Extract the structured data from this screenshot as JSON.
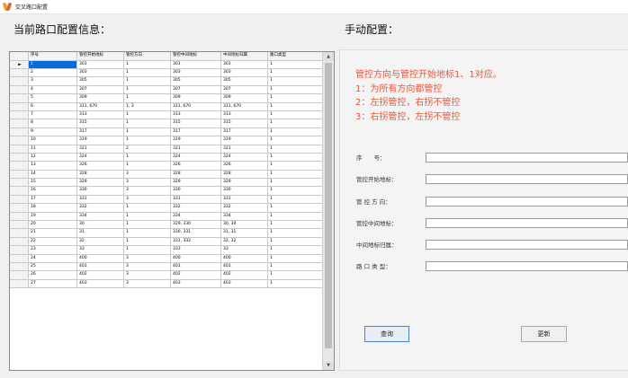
{
  "window": {
    "title": "交叉路口配置"
  },
  "left": {
    "heading": "当前路口配置信息："
  },
  "right": {
    "heading": "手动配置：",
    "notes": [
      "管控方向与管控开始地标1、1对应。",
      "1：为所有方向都管控",
      "2：左拐管控，右拐不管控",
      "3：右拐管控，左拐不管控"
    ],
    "form": [
      {
        "label": "序　　号：",
        "value": ""
      },
      {
        "label": "管控开始地标：",
        "value": ""
      },
      {
        "label": "管 控 方 向：",
        "value": ""
      },
      {
        "label": "管控中间地标：",
        "value": ""
      },
      {
        "label": "中间地标归属：",
        "value": ""
      },
      {
        "label": "路 口 类 型：",
        "value": ""
      }
    ],
    "buttons": {
      "query": "查询",
      "update": "更新"
    }
  },
  "grid": {
    "selected_indicator": "►",
    "columns": [
      "序号",
      "管控开始地标",
      "管控方向",
      "管控中间地标",
      "中间地标归属",
      "路口类型"
    ],
    "rows": [
      [
        "1",
        "301",
        "1",
        "301",
        "301",
        "1"
      ],
      [
        "2",
        "303",
        "1",
        "303",
        "303",
        "1"
      ],
      [
        "3",
        "305",
        "1",
        "305",
        "305",
        "1"
      ],
      [
        "4",
        "307",
        "1",
        "307",
        "307",
        "1"
      ],
      [
        "5",
        "309",
        "1",
        "309",
        "309",
        "1"
      ],
      [
        "6",
        "311, 670",
        "1, 3",
        "311, 670",
        "311, 670",
        "1"
      ],
      [
        "7",
        "313",
        "1",
        "313",
        "313",
        "1"
      ],
      [
        "8",
        "315",
        "1",
        "315",
        "315",
        "1"
      ],
      [
        "9",
        "317",
        "1",
        "317",
        "317",
        "1"
      ],
      [
        "10",
        "319",
        "1",
        "319",
        "319",
        "1"
      ],
      [
        "11",
        "321",
        "2",
        "321",
        "321",
        "1"
      ],
      [
        "12",
        "324",
        "1",
        "324",
        "324",
        "1"
      ],
      [
        "13",
        "326",
        "1",
        "326",
        "326",
        "1"
      ],
      [
        "14",
        "328",
        "3",
        "328",
        "328",
        "1"
      ],
      [
        "15",
        "329",
        "3",
        "329",
        "329",
        "1"
      ],
      [
        "16",
        "330",
        "3",
        "330",
        "330",
        "1"
      ],
      [
        "17",
        "331",
        "3",
        "331",
        "331",
        "1"
      ],
      [
        "18",
        "332",
        "1",
        "332",
        "332",
        "1"
      ],
      [
        "19",
        "334",
        "1",
        "334",
        "334",
        "1"
      ],
      [
        "20",
        "30",
        "1",
        "329, 330",
        "30, 30",
        "1"
      ],
      [
        "21",
        "31",
        "1",
        "330, 331",
        "31, 31",
        "1"
      ],
      [
        "22",
        "32",
        "1",
        "331, 332",
        "32, 32",
        "1"
      ],
      [
        "23",
        "33",
        "1",
        "333",
        "33",
        "1"
      ],
      [
        "24",
        "400",
        "3",
        "400",
        "400",
        "1"
      ],
      [
        "25",
        "401",
        "3",
        "401",
        "401",
        "1"
      ],
      [
        "26",
        "402",
        "3",
        "402",
        "402",
        "1"
      ],
      [
        "27",
        "403",
        "3",
        "403",
        "403",
        "1"
      ]
    ]
  }
}
